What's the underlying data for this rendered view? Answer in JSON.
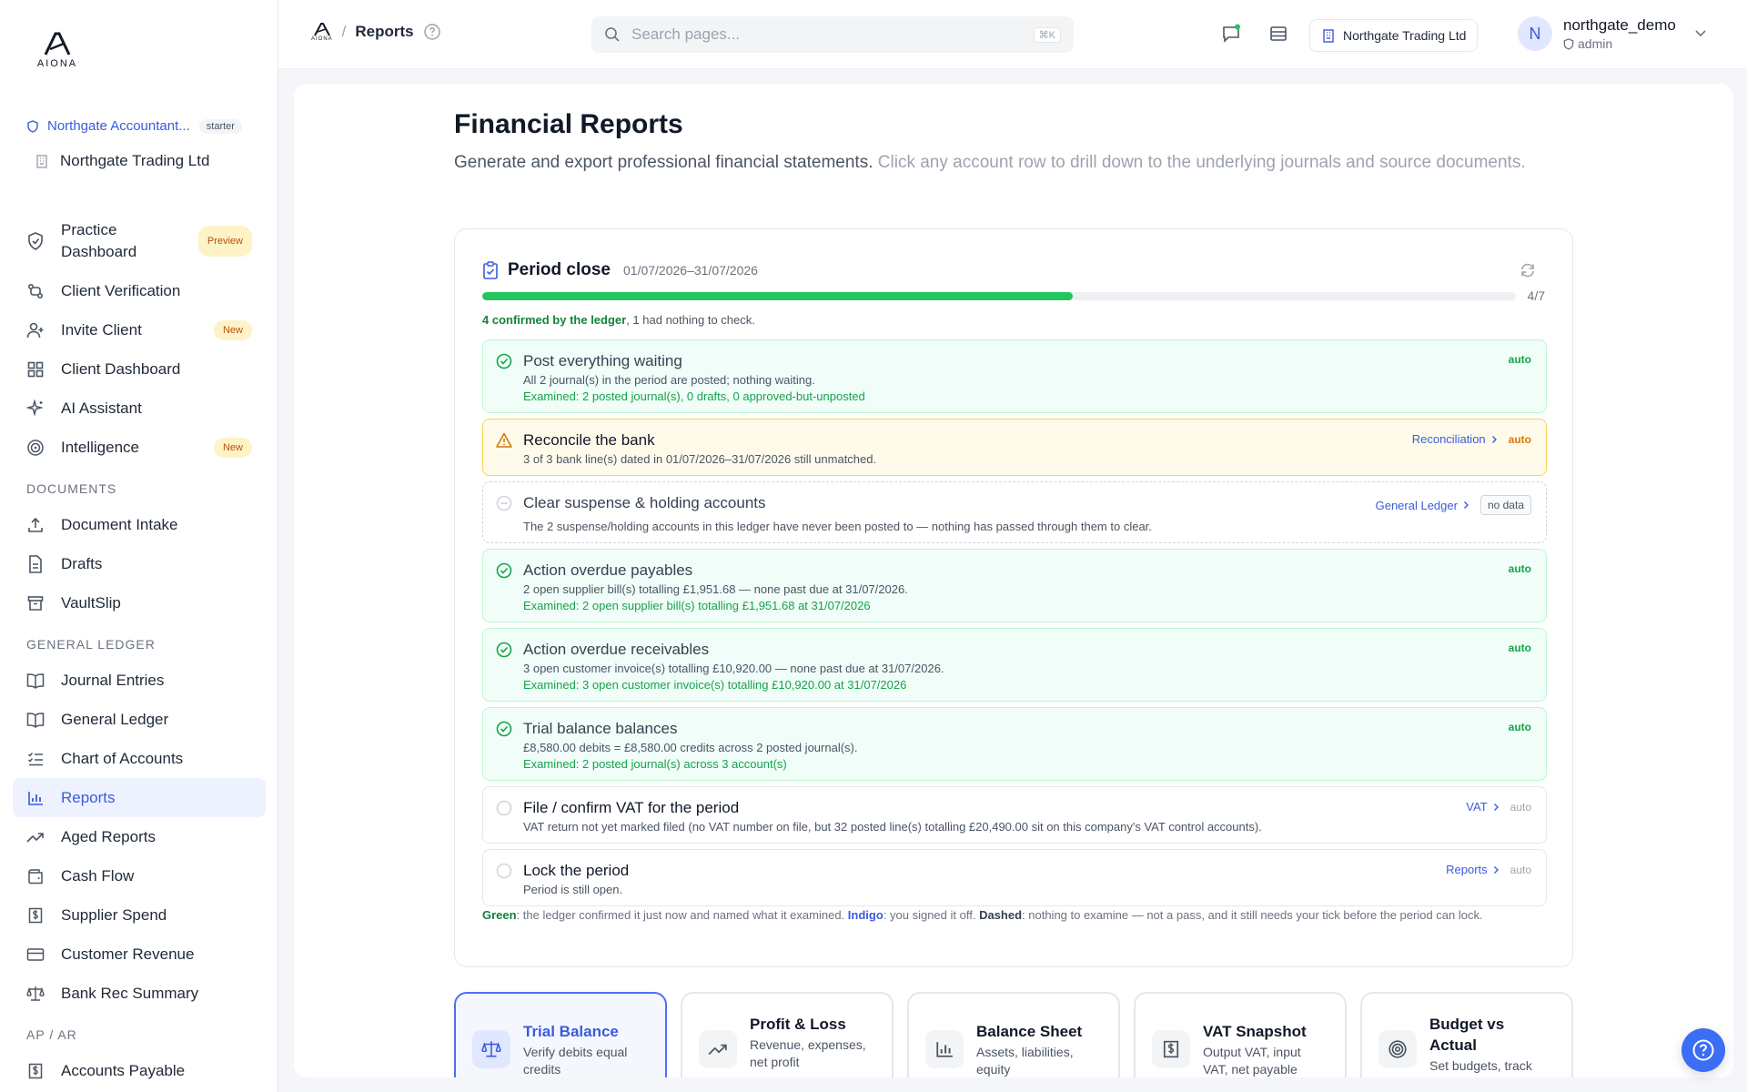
{
  "brand": {
    "logo_text": "AIONA"
  },
  "sidebar": {
    "org_name": "Northgate Accountant...",
    "plan": "starter",
    "company": "Northgate Trading Ltd",
    "items_top": [
      {
        "label": "Practice Dashboard",
        "badge": "Preview"
      },
      {
        "label": "Client Verification"
      },
      {
        "label": "Invite Client",
        "badge": "New"
      },
      {
        "label": "Client Dashboard"
      },
      {
        "label": "AI Assistant"
      },
      {
        "label": "Intelligence",
        "badge": "New"
      }
    ],
    "sections": {
      "documents": "DOCUMENTS",
      "general_ledger": "GENERAL LEDGER",
      "ap_ar": "AP / AR"
    },
    "documents": [
      "Document Intake",
      "Drafts",
      "VaultSlip"
    ],
    "ledger": [
      "Journal Entries",
      "General Ledger",
      "Chart of Accounts",
      "Reports",
      "Aged Reports",
      "Cash Flow",
      "Supplier Spend",
      "Customer Revenue",
      "Bank Rec Summary"
    ],
    "apar": [
      "Accounts Payable"
    ]
  },
  "topbar": {
    "breadcrumb_logo": "AIONA",
    "breadcrumb_sep": "/",
    "page": "Reports",
    "search_placeholder": "Search pages...",
    "search_kbd": "⌘K",
    "company": "Northgate Trading Ltd",
    "user_initial": "N",
    "username": "northgate_demo",
    "role": "admin"
  },
  "page": {
    "title": "Financial Reports",
    "subtitle_main": "Generate and export professional financial statements.",
    "subtitle_hint": "Click any account row to drill down to the underlying journals and source documents."
  },
  "period_close": {
    "title": "Period close",
    "range": "01/07/2026–31/07/2026",
    "progress_fraction": 0.571,
    "progress_label": "4/7",
    "summary_confirmed": "4 confirmed by the ledger",
    "summary_rest": ", 1 had nothing to check.",
    "checks": [
      {
        "title": "Post everything waiting",
        "desc": "All 2 journal(s) in the period are posted; nothing waiting.",
        "examined": "Examined: 2 posted journal(s), 0 drafts, 0 approved-but-unposted",
        "tag": "auto"
      },
      {
        "title": "Reconcile the bank",
        "desc": "3 of 3 bank line(s) dated in 01/07/2026–31/07/2026 still unmatched.",
        "link": "Reconciliation",
        "tag": "auto"
      },
      {
        "title": "Clear suspense & holding accounts",
        "desc": "The 2 suspense/holding accounts in this ledger have never been posted to — nothing has passed through them to clear.",
        "link": "General Ledger",
        "tag": "no data"
      },
      {
        "title": "Action overdue payables",
        "desc": "2 open supplier bill(s) totalling £1,951.68 — none past due at 31/07/2026.",
        "examined": "Examined: 2 open supplier bill(s) totalling £1,951.68 at 31/07/2026",
        "tag": "auto"
      },
      {
        "title": "Action overdue receivables",
        "desc": "3 open customer invoice(s) totalling £10,920.00 — none past due at 31/07/2026.",
        "examined": "Examined: 3 open customer invoice(s) totalling £10,920.00 at 31/07/2026",
        "tag": "auto"
      },
      {
        "title": "Trial balance balances",
        "desc": "£8,580.00 debits = £8,580.00 credits across 2 posted journal(s).",
        "examined": "Examined: 2 posted journal(s) across 3 account(s)",
        "tag": "auto"
      },
      {
        "title": "File / confirm VAT for the period",
        "desc": "VAT return not yet marked filed (no VAT number on file, but 32 posted line(s) totalling £20,490.00 sit on this company's VAT control accounts).",
        "link": "VAT",
        "tag": "auto"
      },
      {
        "title": "Lock the period",
        "desc": "Period is still open.",
        "link": "Reports",
        "tag": "auto"
      }
    ],
    "legend": {
      "green_label": "Green",
      "green_text": ": the ledger confirmed it just now and named what it examined. ",
      "indigo_label": "Indigo",
      "indigo_text": ": you signed it off. ",
      "dashed_label": "Dashed",
      "dashed_text": ": nothing to examine — not a pass, and it still needs your tick before the period can lock."
    }
  },
  "reports": [
    {
      "name": "Trial Balance",
      "desc": "Verify debits equal credits"
    },
    {
      "name": "Profit & Loss",
      "desc": "Revenue, expenses, net profit"
    },
    {
      "name": "Balance Sheet",
      "desc": "Assets, liabilities, equity"
    },
    {
      "name": "VAT Snapshot",
      "desc": "Output VAT, input VAT, net payable"
    },
    {
      "name": "Budget vs Actual",
      "desc": "Set budgets, track variance"
    }
  ],
  "colors": {
    "accent": "#3b5bdb",
    "success": "#22c55e",
    "warning": "#f59e0b"
  }
}
